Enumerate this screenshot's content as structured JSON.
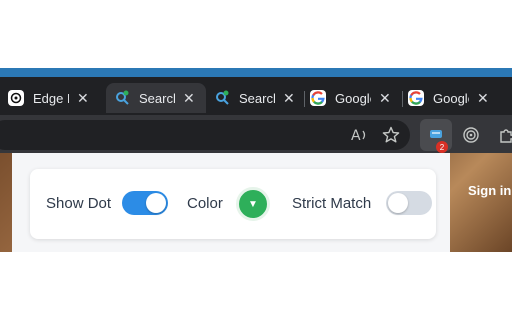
{
  "tabs": [
    {
      "title": "Edge E",
      "favicon": "chatgpt-icon",
      "active": false
    },
    {
      "title": "Search",
      "favicon": "search-extension-icon",
      "active": true
    },
    {
      "title": "Search",
      "favicon": "search-extension-icon",
      "active": false
    },
    {
      "title": "Google",
      "favicon": "google-icon",
      "active": false
    },
    {
      "title": "Google",
      "favicon": "google-icon",
      "active": false
    }
  ],
  "tab_close_glyph": "✕",
  "toolbar": {
    "read_aloud_icon": "read-aloud-icon",
    "favorite_icon": "star-icon",
    "extension_badge": "2",
    "copilot_icon": "copilot-icon",
    "extensions_icon": "puzzle-icon"
  },
  "page": {
    "sign_in": "Sign in"
  },
  "popup": {
    "show_dot_label": "Show Dot",
    "show_dot_on": true,
    "color_label": "Color",
    "color_value": "#2eaf5a",
    "strict_match_label": "Strict Match",
    "strict_match_on": false
  },
  "colors": {
    "accent": "#2c8ce6",
    "chrome_bg": "#202124",
    "badge": "#d93025"
  }
}
